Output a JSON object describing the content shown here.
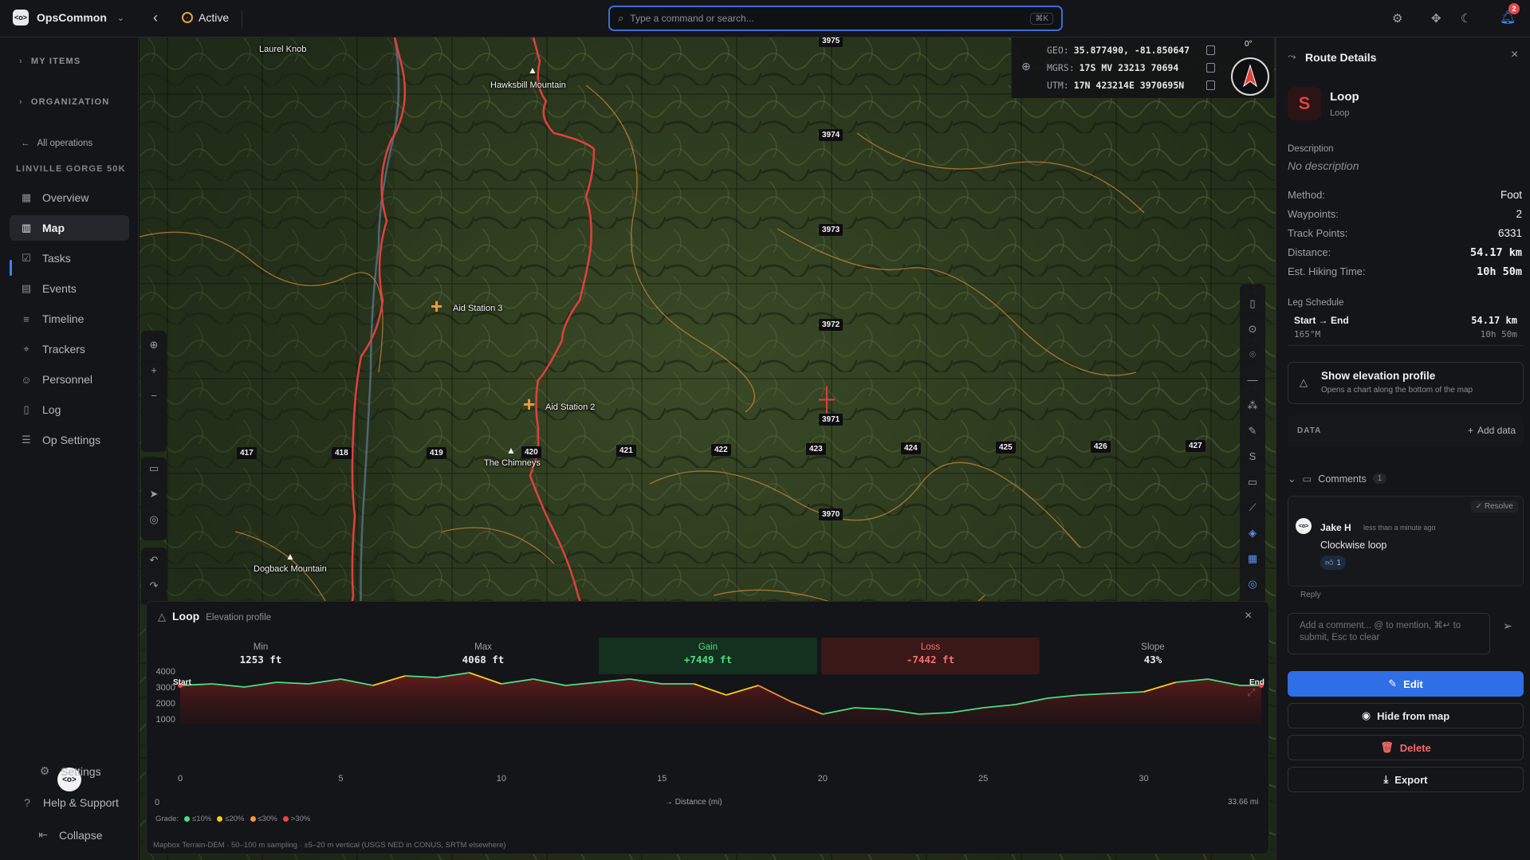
{
  "app": {
    "name": "OpsCommon",
    "status": "Active",
    "notifications": "2"
  },
  "search": {
    "placeholder": "Type a command or search...",
    "shortcut": "⌘K"
  },
  "sidebar": {
    "my_items": "MY ITEMS",
    "organization": "ORGANIZATION",
    "all_operations": "All operations",
    "operation_name": "LINVILLE GORGE 50K",
    "items": [
      {
        "label": "Overview",
        "icon": "grid-icon"
      },
      {
        "label": "Map",
        "icon": "map-icon"
      },
      {
        "label": "Tasks",
        "icon": "checkbox-icon"
      },
      {
        "label": "Events",
        "icon": "calendar-icon"
      },
      {
        "label": "Timeline",
        "icon": "timeline-icon"
      },
      {
        "label": "Trackers",
        "icon": "tracker-icon"
      },
      {
        "label": "Personnel",
        "icon": "person-icon"
      },
      {
        "label": "Log",
        "icon": "book-icon"
      },
      {
        "label": "Op Settings",
        "icon": "sliders-icon"
      }
    ],
    "active_index": 1,
    "bottom": {
      "settings": "Settings",
      "help": "Help & Support",
      "collapse": "Collapse"
    }
  },
  "map": {
    "coords": {
      "geo_label": "GEO:",
      "geo": "35.877490, -81.850647",
      "mgrs_label": "MGRS:",
      "mgrs": "17S MV 23213 70694",
      "utm_label": "UTM:",
      "utm": "17N 423214E 3970695N"
    },
    "heading": "0°",
    "places": [
      "Laurel Knob",
      "Hawksbill Mountain",
      "The Chimneys",
      "Dogback Mountain"
    ],
    "aid_stations": [
      "Aid Station 3",
      "Aid Station 2"
    ],
    "grid_north": [
      "3975",
      "3974",
      "3973",
      "3972",
      "3971",
      "3970"
    ],
    "grid_east": [
      "417",
      "418",
      "419",
      "420",
      "421",
      "422",
      "423",
      "424",
      "425",
      "426",
      "427"
    ]
  },
  "elevation": {
    "title": "Loop",
    "subtitle": "Elevation profile",
    "stats": [
      {
        "label": "Min",
        "value": "1253 ft"
      },
      {
        "label": "Max",
        "value": "4068 ft"
      },
      {
        "label": "Gain",
        "value": "+7449 ft"
      },
      {
        "label": "Loss",
        "value": "-7442 ft"
      },
      {
        "label": "Slope",
        "value": "43%"
      }
    ],
    "start_label": "Start",
    "end_label": "End",
    "x_label": "Distance (mi)",
    "total": "33.66 mi",
    "zero": "0",
    "grade_label": "Grade:",
    "grades": [
      "≤10%",
      "≤20%",
      "≤30%",
      ">30%"
    ],
    "grade_colors": [
      "#4ade80",
      "#facc15",
      "#fb923c",
      "#ef4444"
    ],
    "source": "Mapbox Terrain-DEM · 50–100 m sampling · ±5–20 m vertical (USGS NED in CONUS, SRTM elsewhere)",
    "chart_data": {
      "type": "area",
      "x": [
        0,
        1,
        2,
        3,
        4,
        5,
        6,
        7,
        8,
        9,
        10,
        11,
        12,
        13,
        14,
        15,
        16,
        17,
        18,
        19,
        20,
        21,
        22,
        23,
        24,
        25,
        26,
        27,
        28,
        29,
        30,
        31,
        32,
        33,
        33.66
      ],
      "y": [
        3100,
        3200,
        3000,
        3300,
        3200,
        3500,
        3100,
        3700,
        3600,
        3900,
        3200,
        3500,
        3100,
        3300,
        3500,
        3200,
        3200,
        2500,
        3100,
        2100,
        1300,
        1700,
        1600,
        1300,
        1400,
        1700,
        1900,
        2300,
        2500,
        2600,
        2700,
        3300,
        3500,
        3100,
        3100
      ],
      "xlim": [
        0,
        33.66
      ],
      "ylim": [
        1000,
        4000
      ],
      "xticks": [
        0,
        5,
        10,
        15,
        20,
        25,
        30
      ],
      "yticks": [
        1000,
        2000,
        3000,
        4000
      ],
      "xlabel": "Distance (mi)"
    }
  },
  "panel": {
    "title": "Route Details",
    "route_name": "Loop",
    "route_type": "Loop",
    "description_label": "Description",
    "description": "No description",
    "fields": [
      {
        "label": "Method:",
        "value": "Foot"
      },
      {
        "label": "Waypoints:",
        "value": "2"
      },
      {
        "label": "Track Points:",
        "value": "6331"
      },
      {
        "label": "Distance:",
        "value": "54.17 km"
      },
      {
        "label": "Est. Hiking Time:",
        "value": "10h 50m"
      }
    ],
    "leg_schedule_label": "Leg Schedule",
    "leg": {
      "name": "Start → End",
      "bearing": "165°M",
      "distance": "54.17 km",
      "time": "10h 50m"
    },
    "elevation_btn": {
      "title": "Show elevation profile",
      "subtitle": "Opens a chart along the bottom of the map"
    },
    "data_label": "DATA",
    "add_data": "Add data",
    "comments_label": "Comments",
    "comments_count": "1",
    "resolve": "Resolve",
    "comment": {
      "author": "Jake H",
      "time": "less than a minute ago",
      "text": "Clockwise loop",
      "reaction_count": "1"
    },
    "reply": "Reply",
    "comment_placeholder": "Add a comment... @ to mention, ⌘↵ to submit, Esc to clear",
    "buttons": {
      "edit": "Edit",
      "hide": "Hide from map",
      "delete": "Delete",
      "export": "Export"
    }
  }
}
